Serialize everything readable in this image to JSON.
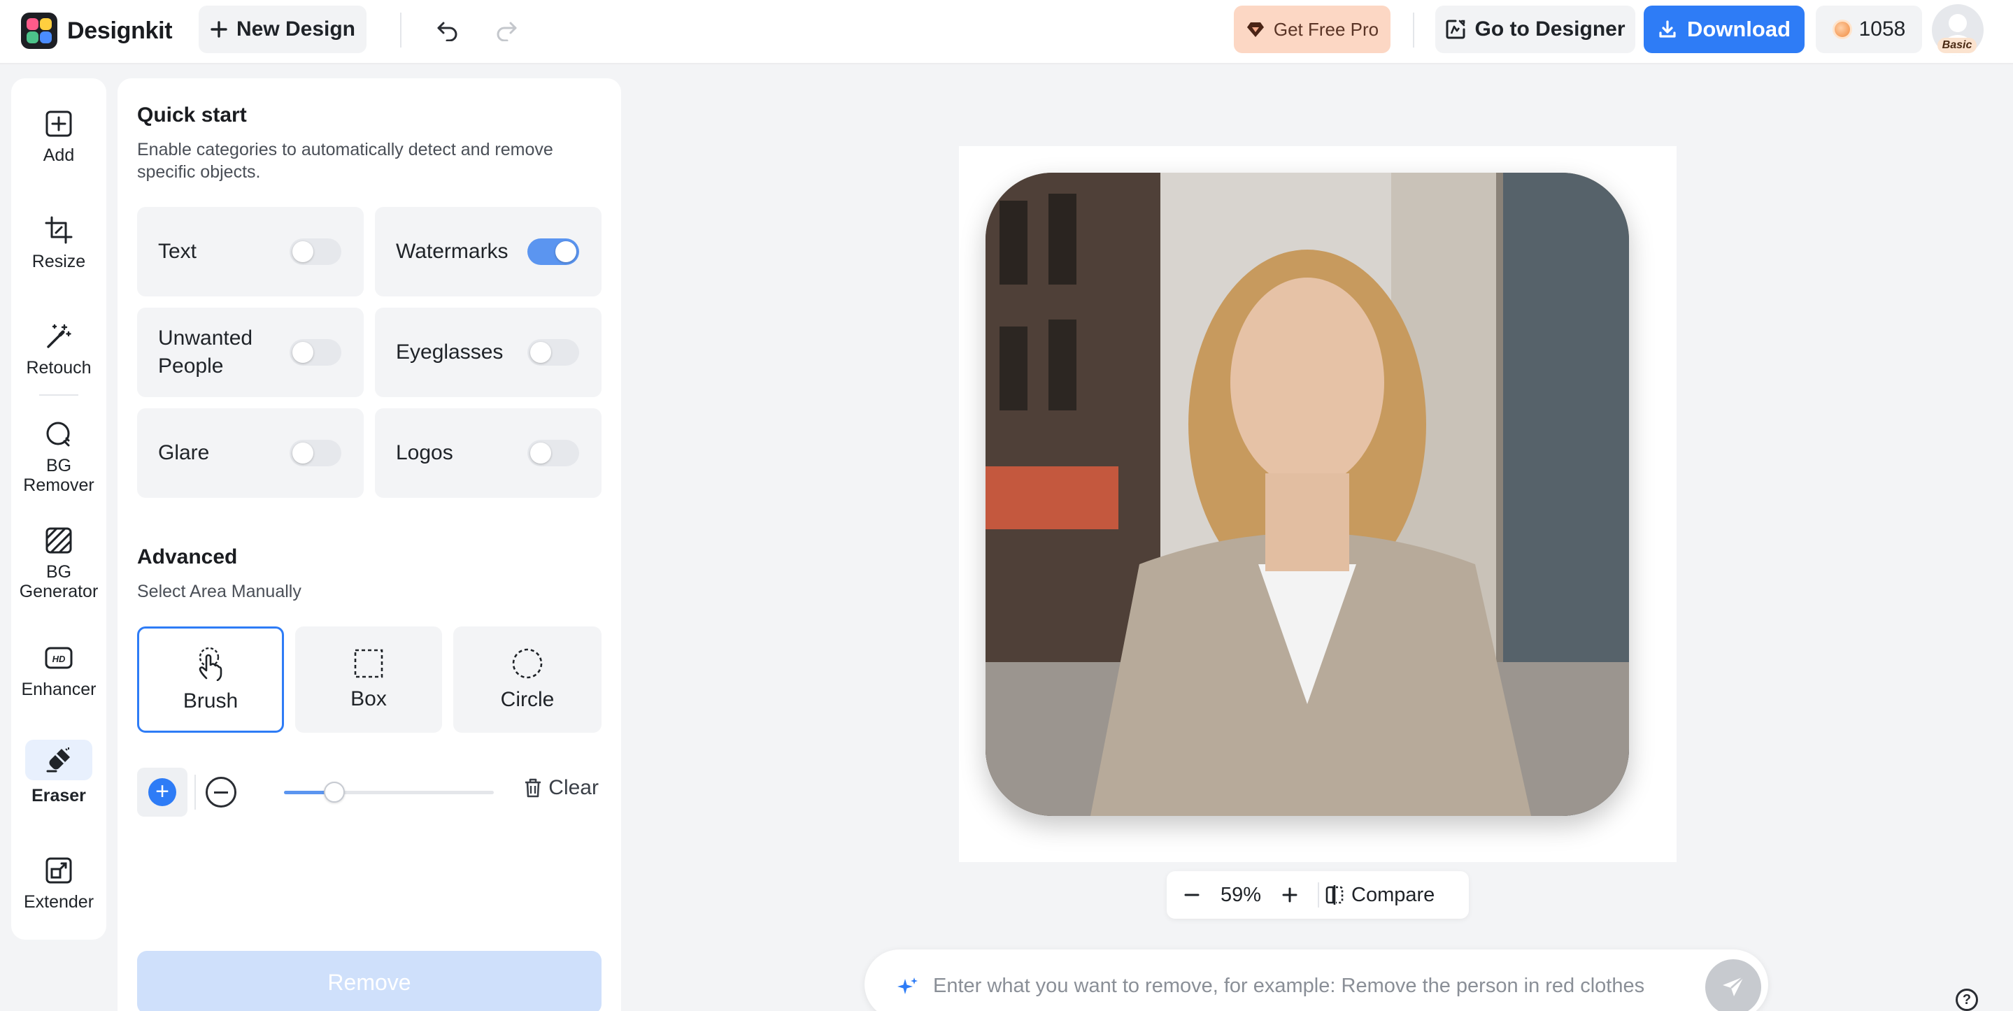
{
  "app": {
    "name": "Designkit"
  },
  "header": {
    "new_design": "New Design",
    "get_pro": "Get Free Pro",
    "go_designer": "Go to Designer",
    "download": "Download",
    "credits": "1058",
    "plan_badge": "Basic"
  },
  "rail": {
    "items": [
      {
        "label": "Add",
        "icon": "plus-square-icon"
      },
      {
        "label": "Resize",
        "icon": "crop-icon"
      },
      {
        "label": "Retouch",
        "icon": "magic-wand-icon"
      },
      {
        "label": "BG Remover",
        "icon": "bg-remover-icon"
      },
      {
        "label": "BG Generator",
        "icon": "hatched-square-icon"
      },
      {
        "label": "Enhancer",
        "icon": "hd-icon"
      },
      {
        "label": "Eraser",
        "icon": "eraser-icon",
        "active": true
      },
      {
        "label": "Extender",
        "icon": "expand-icon"
      }
    ]
  },
  "panel": {
    "quick_start_title": "Quick start",
    "quick_start_desc": "Enable categories to automatically detect and remove specific objects.",
    "toggles": [
      {
        "label": "Text",
        "on": false
      },
      {
        "label": "Watermarks",
        "on": true
      },
      {
        "label": "Unwanted People",
        "on": false
      },
      {
        "label": "Eyeglasses",
        "on": false
      },
      {
        "label": "Glare",
        "on": false
      },
      {
        "label": "Logos",
        "on": false
      }
    ],
    "advanced_title": "Advanced",
    "advanced_desc": "Select Area Manually",
    "modes": [
      {
        "label": "Brush",
        "icon": "brush-hand-icon",
        "active": true
      },
      {
        "label": "Box",
        "icon": "dashed-box-icon",
        "active": false
      },
      {
        "label": "Circle",
        "icon": "dashed-circle-icon",
        "active": false
      }
    ],
    "brush_size_fraction": 0.24,
    "clear": "Clear",
    "remove": "Remove"
  },
  "canvas": {
    "zoom": "59%",
    "compare": "Compare",
    "prompt_placeholder": "Enter what you want to remove, for example: Remove the person in red clothes"
  },
  "colors": {
    "accent": "#2e7cf6",
    "switch_on": "#5b95f0",
    "pro_bg": "#fcd7c4"
  }
}
